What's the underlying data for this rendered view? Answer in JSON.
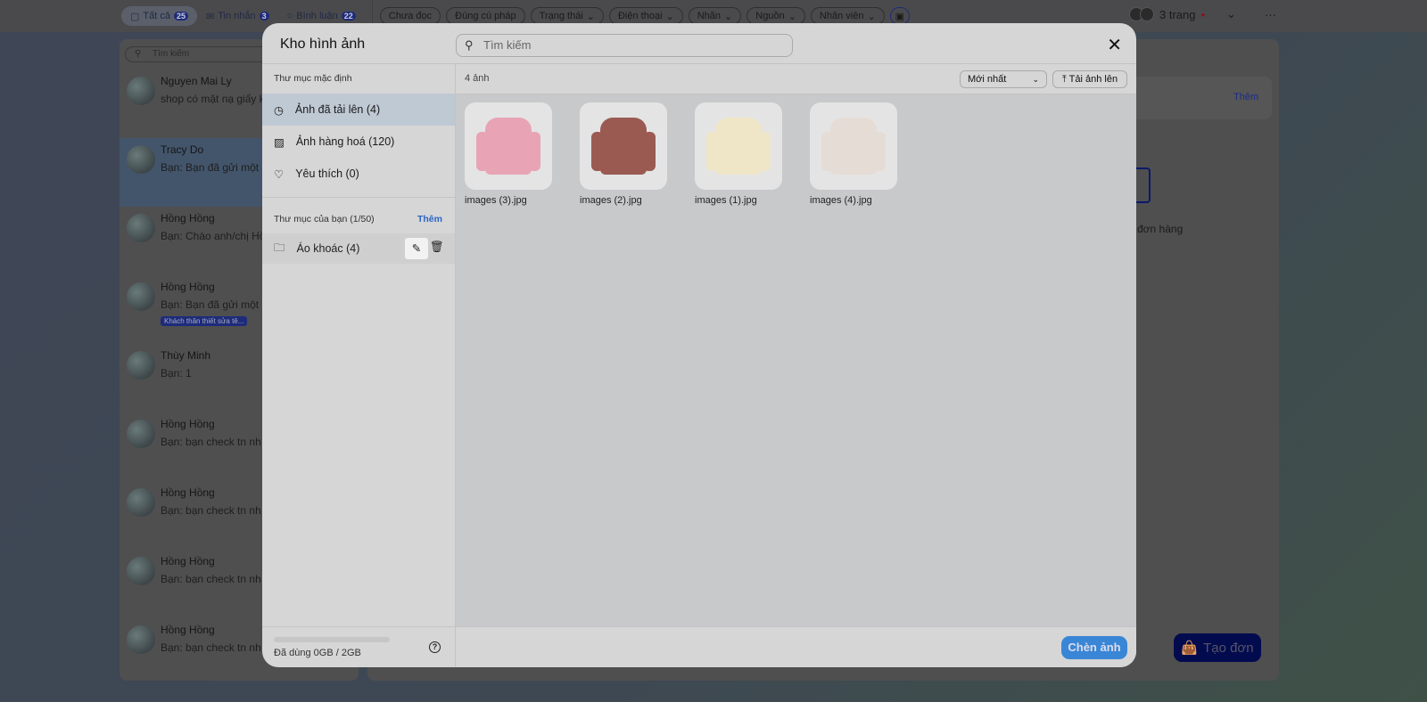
{
  "topbar": {
    "tabs": [
      {
        "label": "Tất cả",
        "count": "25"
      },
      {
        "label": "Tin nhắn",
        "count": "3"
      },
      {
        "label": "Bình luận",
        "count": "22"
      }
    ],
    "filters": [
      "Chưa đọc",
      "Đúng cú pháp",
      "Trạng thái",
      "Điện thoại",
      "Nhãn",
      "Nguồn",
      "Nhân viên"
    ],
    "pages_label": "3 trang"
  },
  "conversations": {
    "search_placeholder": "Tìm kiếm",
    "items": [
      {
        "name": "Nguyen Mai Ly",
        "message": "shop có mặt nạ giấy k"
      },
      {
        "name": "Tracy Do",
        "message": "Bạn: Bạn đã gửi một ả"
      },
      {
        "name": "Hồng Hồng",
        "message": "Bạn: Chào anh/chị Hồ"
      },
      {
        "name": "Hồng Hồng",
        "message": "Bạn: Bạn đã gửi một ả",
        "tag": "Khách thân thiết sửa tê..."
      },
      {
        "name": "Thùy Minh",
        "message": "Bạn: 1"
      },
      {
        "name": "Hồng Hồng",
        "message": "Bạn: bạn check tn nh"
      },
      {
        "name": "Hồng Hồng",
        "message": "Bạn: bạn check tn nh"
      },
      {
        "name": "Hồng Hồng",
        "message": "Bạn: bạn check tn nh"
      },
      {
        "name": "Hồng Hồng",
        "message": "Bạn: bạn check tn nh"
      }
    ]
  },
  "right": {
    "more_label": "Thêm",
    "empty_text": "đơn hàng",
    "create_order": "Tạo đơn"
  },
  "modal": {
    "title": "Kho hình ảnh",
    "search_placeholder": "Tìm kiếm",
    "default_folders_title": "Thư mục mặc định",
    "default_folders": [
      {
        "label": "Ảnh đã tải lên (4)",
        "icon": "clock-icon",
        "selected": true
      },
      {
        "label": "Ảnh hàng hoá (120)",
        "icon": "image-icon"
      },
      {
        "label": "Yêu thích (0)",
        "icon": "heart-icon"
      }
    ],
    "your_folders_title": "Thư mục của bạn (1/50)",
    "add_folder": "Thêm",
    "your_folders": [
      {
        "label": "Áo khoác (4)"
      }
    ],
    "storage": {
      "used_label": "Đã dùng 0GB / 2GB",
      "used_fraction": 0
    },
    "count_label": "4 ảnh",
    "sort_value": "Mới nhất",
    "upload_label": "Tải ảnh lên",
    "images": [
      {
        "name": "images (3).jpg",
        "color": "#e8a4b4"
      },
      {
        "name": "images (2).jpg",
        "color": "#9a5a52"
      },
      {
        "name": "images (1).jpg",
        "color": "#efe6c8"
      },
      {
        "name": "images (4).jpg",
        "color": "#e6dcd6"
      }
    ],
    "insert_label": "Chèn ảnh",
    "accent": "#3a86d6"
  }
}
